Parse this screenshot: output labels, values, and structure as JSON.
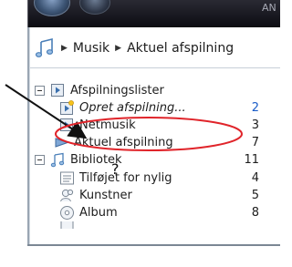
{
  "topbar": {
    "text": "AN"
  },
  "breadcrumb": {
    "items": [
      "Musik",
      "Aktuel afspilning"
    ]
  },
  "tree": {
    "playlists_label": "Afspilningslister",
    "create_playlist_label": "Opret afspilning...",
    "create_playlist_count": "2",
    "netmusik_label": "Netmusik",
    "netmusik_count": "3",
    "now_playing_label": "Aktuel afspilning",
    "now_playing_count": "7",
    "library_label": "Bibliotek",
    "library_count": "11",
    "recently_added_label": "Tilføjet for nylig",
    "recently_added_count": "4",
    "artist_label": "Kunstner",
    "artist_count": "5",
    "album_label": "Album",
    "album_count": "8"
  },
  "annotation": {
    "question_mark": "?",
    "highlight_color": "#e0242a"
  },
  "colors": {
    "accent": "#1a5cc8",
    "highlight": "#e0242a"
  }
}
